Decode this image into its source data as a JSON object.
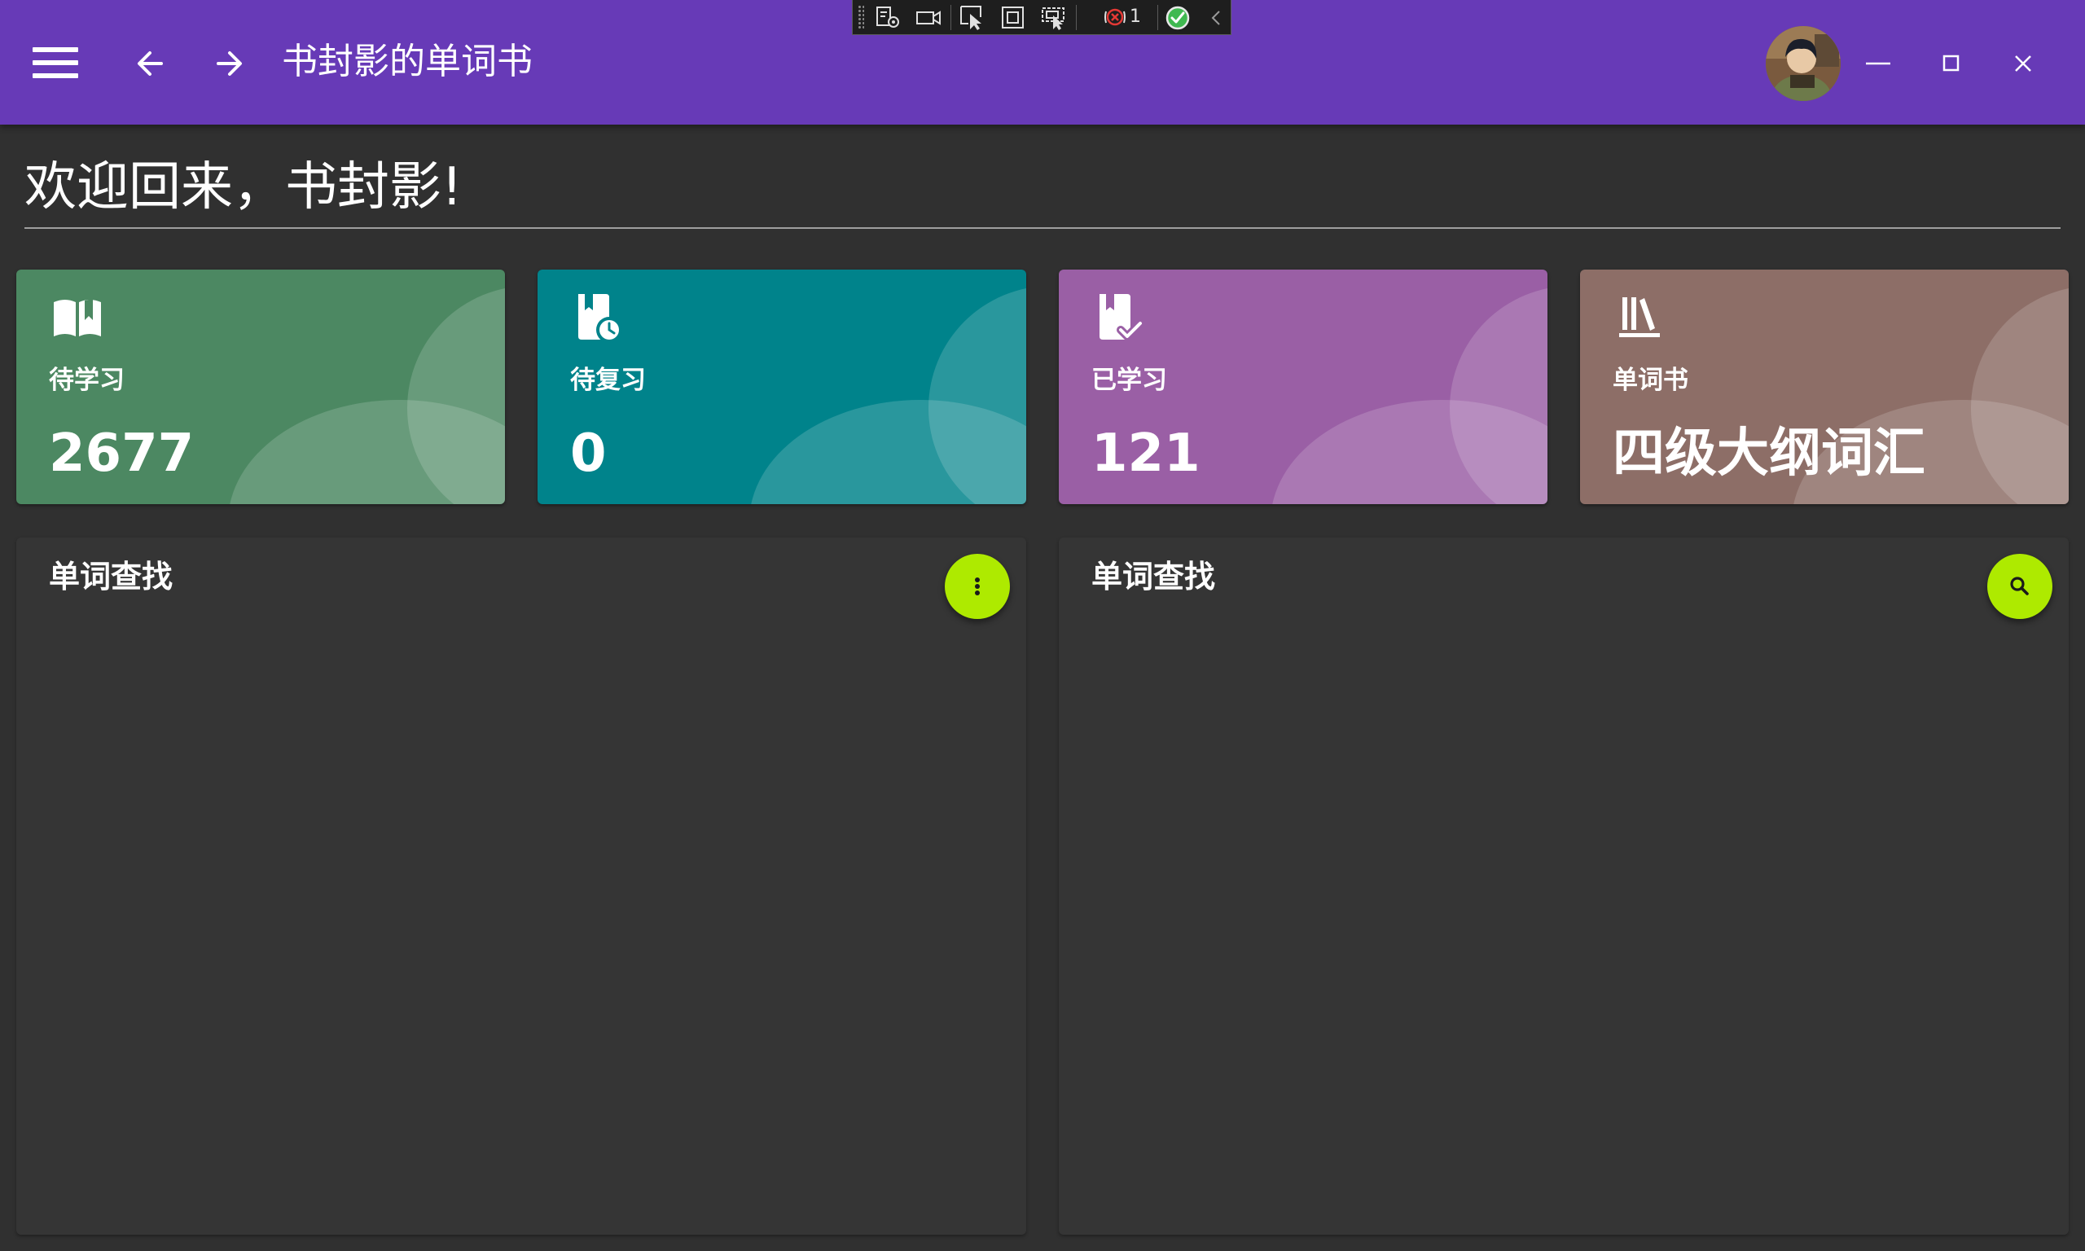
{
  "window": {
    "title": "书封影的单词书"
  },
  "header": {
    "menu_icon": "hamburger-menu-icon",
    "back_icon": "arrow-back-icon",
    "forward_icon": "arrow-forward-icon",
    "avatar_icon": "user-avatar",
    "minimize_icon": "minimize-icon",
    "maximize_icon": "maximize-icon",
    "close_icon": "close-icon"
  },
  "debug_toolbar": {
    "icons": [
      "live-visual-tree-icon",
      "record-video-icon",
      "select-element-icon",
      "display-layout-adorners-icon",
      "track-focus-icon",
      "binding-failures-icon",
      "hot-reload-status-icon",
      "collapse-chevron-icon"
    ],
    "binding_failures_count": "1"
  },
  "welcome": {
    "text": "欢迎回来，书封影!"
  },
  "stats": [
    {
      "label": "待学习",
      "value": "2677",
      "icon": "book-open-icon",
      "color": "#4c8862"
    },
    {
      "label": "待复习",
      "value": "0",
      "icon": "book-clock-icon",
      "color": "#00838b"
    },
    {
      "label": "已学习",
      "value": "121",
      "icon": "book-check-icon",
      "color": "#9a5fa5"
    },
    {
      "label": "单词书",
      "value": "四级大纲词汇",
      "icon": "bookshelf-icon",
      "color": "#8d6e67"
    }
  ],
  "panels": [
    {
      "title": "单词查找",
      "fab_icon": "more-vertical-icon"
    },
    {
      "title": "单词查找",
      "fab_icon": "search-icon"
    }
  ],
  "colors": {
    "appbar": "#673ab7",
    "background": "#303030",
    "panel": "#353535",
    "fab": "#aeea00"
  }
}
